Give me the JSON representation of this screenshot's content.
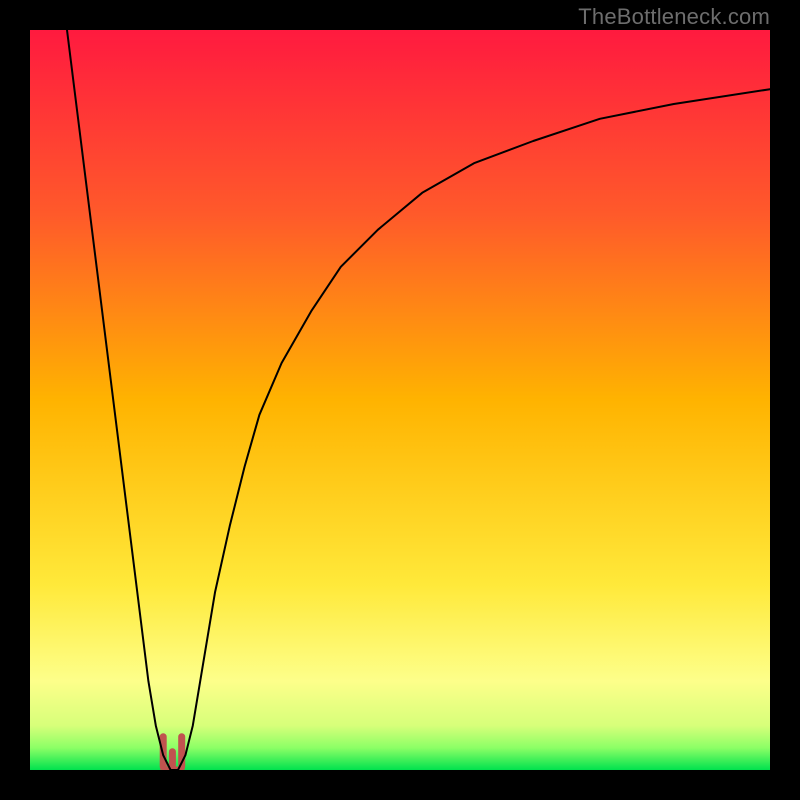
{
  "watermark": "TheBottleneck.com",
  "chart_data": {
    "type": "line",
    "title": "",
    "xlabel": "",
    "ylabel": "",
    "xlim": [
      0,
      100
    ],
    "ylim": [
      0,
      100
    ],
    "grid": false,
    "legend": false,
    "gradient_stops": [
      {
        "offset": 0.0,
        "color": "#ff1a3f"
      },
      {
        "offset": 0.25,
        "color": "#ff5a2a"
      },
      {
        "offset": 0.5,
        "color": "#ffb300"
      },
      {
        "offset": 0.75,
        "color": "#ffe93a"
      },
      {
        "offset": 0.88,
        "color": "#fdff8a"
      },
      {
        "offset": 0.94,
        "color": "#d7ff7a"
      },
      {
        "offset": 0.97,
        "color": "#8cff66"
      },
      {
        "offset": 1.0,
        "color": "#00e24e"
      }
    ],
    "series": [
      {
        "name": "bottleneck-curve",
        "color": "#000000",
        "width": 2,
        "x": [
          5,
          6,
          7,
          8,
          9,
          10,
          11,
          12,
          13,
          14,
          15,
          16,
          17,
          18,
          19,
          20,
          21,
          22,
          23,
          24,
          25,
          27,
          29,
          31,
          34,
          38,
          42,
          47,
          53,
          60,
          68,
          77,
          87,
          100
        ],
        "y": [
          100,
          92,
          84,
          76,
          68,
          60,
          52,
          44,
          36,
          28,
          20,
          12,
          6,
          2,
          0,
          0,
          2,
          6,
          12,
          18,
          24,
          33,
          41,
          48,
          55,
          62,
          68,
          73,
          78,
          82,
          85,
          88,
          90,
          92
        ]
      }
    ],
    "marker": {
      "name": "cusp-marker",
      "color": "#c0534f",
      "x_start": 18,
      "x_end": 20.5,
      "y": 0,
      "height": 4.5,
      "width": 7
    }
  }
}
